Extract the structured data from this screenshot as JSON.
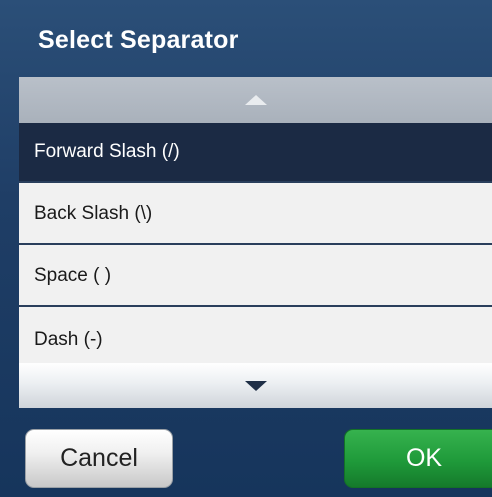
{
  "dialog": {
    "title": "Select Separator"
  },
  "list": {
    "items": [
      {
        "label": "Forward Slash (/)",
        "selected": true
      },
      {
        "label": "Back Slash (\\)",
        "selected": false
      },
      {
        "label": "Space ( )",
        "selected": false
      },
      {
        "label": "Dash (-)",
        "selected": false
      }
    ]
  },
  "icons": {
    "scroll_up": "triangle-up-icon",
    "scroll_down": "triangle-down-icon"
  },
  "buttons": {
    "cancel_label": "Cancel",
    "ok_label": "OK"
  },
  "colors": {
    "header_bg": "#1f3e66",
    "selected_row_bg": "#1b2a44",
    "ok_green": "#1f9a3a"
  }
}
